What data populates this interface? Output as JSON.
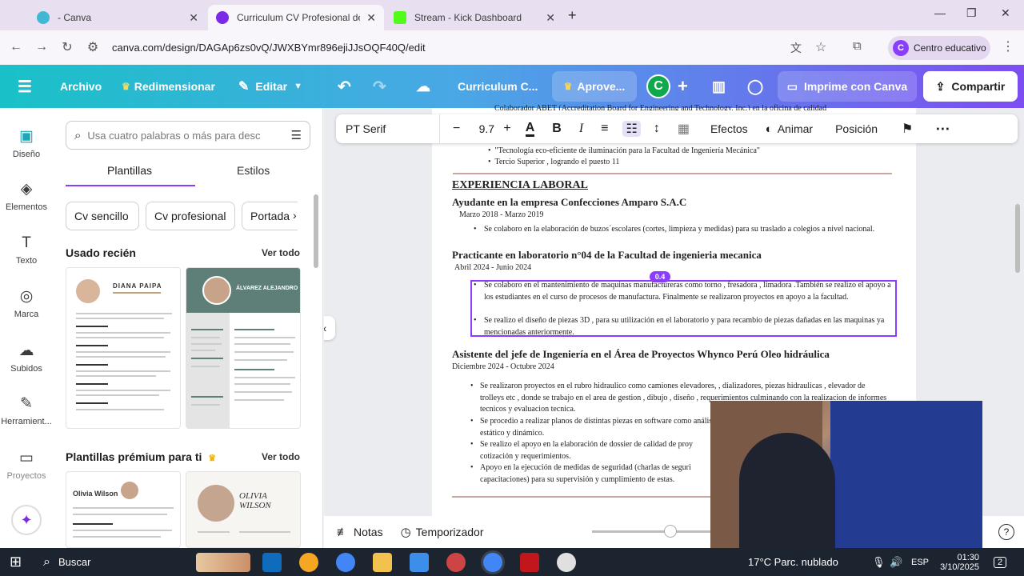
{
  "browser": {
    "tabs": [
      {
        "title": "- Canva",
        "active": false
      },
      {
        "title": "Curriculum CV Profesional de M",
        "active": true
      },
      {
        "title": "Stream - Kick Dashboard",
        "active": false
      }
    ],
    "url": "canva.com/design/DAGAp6zs0vQ/JWXBYmr896ejiJJsOQF40Q/edit",
    "profile": "Centro educativo",
    "profile_initial": "C"
  },
  "toolbar": {
    "archivo": "Archivo",
    "redimensionar": "Redimensionar",
    "editar": "Editar",
    "doc_title": "Curriculum C...",
    "upgrade": "Aprove...",
    "avatar_initial": "C",
    "print": "Imprime con Canva",
    "share": "Compartir",
    "brand_color": "#8b3dff"
  },
  "rail": [
    {
      "label": "Diseño",
      "icon": "layout-icon"
    },
    {
      "label": "Elementos",
      "icon": "elements-icon"
    },
    {
      "label": "Texto",
      "icon": "text-icon"
    },
    {
      "label": "Marca",
      "icon": "brand-icon"
    },
    {
      "label": "Subidos",
      "icon": "upload-icon"
    },
    {
      "label": "Herramient...",
      "icon": "tools-icon"
    },
    {
      "label": "Proyectos",
      "icon": "folder-icon"
    }
  ],
  "panel": {
    "search_placeholder": "Usa cuatro palabras o más para desc",
    "tab_templates": "Plantillas",
    "tab_styles": "Estilos",
    "chips": [
      "Cv sencillo",
      "Cv profesional",
      "Portada"
    ],
    "recent_heading": "Usado recién",
    "see_all": "Ver todo",
    "recent_1_name": "DIANA PAIPA",
    "recent_2_name": "ÁLVAREZ ALEJANDRO",
    "premium_heading": "Plantillas prémium para ti",
    "premium_1_name": "Olivia Wilson",
    "premium_2_name": "OLIVIA WILSON"
  },
  "format": {
    "font": "PT Serif",
    "size": "9.7",
    "effects": "Efectos",
    "animate": "Animar",
    "position": "Posición"
  },
  "doc": {
    "top_cut": "Colaborador ABET (Accreditation Board for Engineering and Technology, Inc.) en la oficina de calidad",
    "top_line1": "\"Tecnología eco-eficiente de iluminación para la Facultad de Ingeniería Mecánica\"",
    "top_line2": "Tercio Superior , logrando el puesto 11",
    "section": "EXPERIENCIA LABORAL",
    "job1_title": "Ayudante en la empresa Confecciones Amparo S.A.C",
    "job1_date": "Marzo 2018 - Marzo 2019",
    "job1_b1": "Se colaboro en la elaboración de buzos´escolares (cortes, limpieza y medidas) para su traslado a colegios a nivel nacional.",
    "job2_title": "Practicante en laboratorio n°04 de la Facultad de ingenieria mecanica",
    "job2_date": "Abril 2024 - Junio 2024",
    "job2_b1": "Se colaboro en el mantenimiento de maquinas manufactureras como torno , fresadora , limadora .También se realizo el apoyo a los estudiantes en el curso de procesos de manufactura. Finalmente se realizaron proyectos en apoyo a la facultad.",
    "job2_b2": "Se realizo el diseño de piezas 3D , para su utilización en el laboratorio y para recambio de piezas dañadas en las maquinas ya mencionadas anteriormente.",
    "job3_title": "Asistente del jefe de Ingeniería en el Área de Proyectos Whynco Perú Oleo hidráulica",
    "job3_date": "Diciembre 2024 - Octubre 2024",
    "job3_b1": "Se realizaron proyectos en el rubro hidraulico como camiones elevadores, , dializadores, piezas hidraulicas , elevador de trolleys etc , donde se trabajo en el area de gestion , dibujo , diseño , requerimientos culminando con la realizacion de informes tecnicos y evaluacion tecnica.",
    "job3_b2": "Se procedio a realizar planos de distintas piezas en software como análisis estático y dinámico.",
    "job3_b3": "Se realizo el apoyo en la elaboración de dossier de calidad de proy cotización y requerimientos.",
    "job3_b4": "Apoyo en la ejecución de medidas de seguridad (charlas de seguri capacitaciones) para su supervisión y cumplimiento de estas.",
    "spacing_badge": "0.4"
  },
  "bottom": {
    "notes": "Notas",
    "timer": "Temporizador"
  },
  "taskbar": {
    "search": "Buscar",
    "weather": "17°C  Parc. nublado",
    "lang": "ESP",
    "time": "01:30",
    "date": "3/10/2025",
    "notif_count": "2"
  }
}
